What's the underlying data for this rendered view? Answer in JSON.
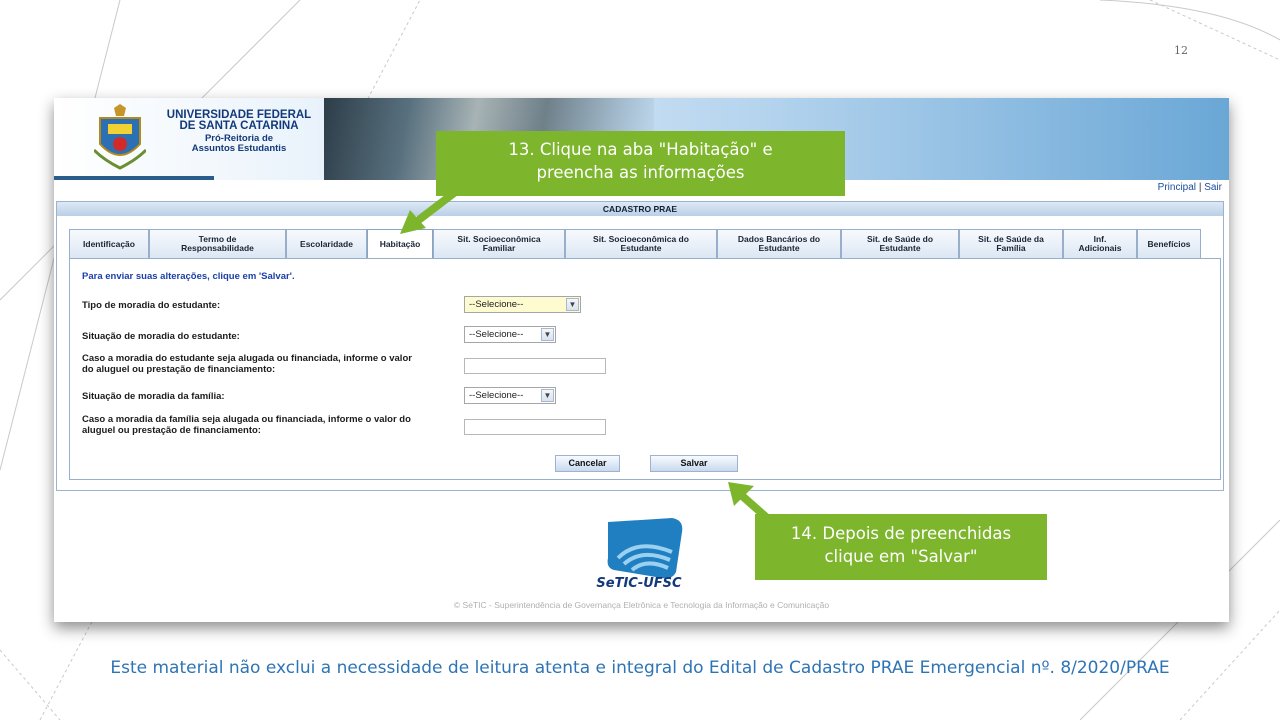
{
  "slide": {
    "page_number": "12",
    "bottom_note": "Este material não exclui a necessidade de leitura atenta e integral do Edital de Cadastro PRAE Emergencial nº. 8/2020/PRAE"
  },
  "header": {
    "university_line1": "UNIVERSIDADE FEDERAL",
    "university_line2": "DE SANTA CATARINA",
    "dept_line1": "Pró-Reitoria de",
    "dept_line2": "Assuntos Estudantis",
    "link_principal": "Principal",
    "link_separator": "|",
    "link_sair": "Sair"
  },
  "callouts": {
    "step13_line1": "13. Clique na aba \"Habitação\" e",
    "step13_line2": "preencha as informações",
    "step14_line1": "14. Depois de preenchidas",
    "step14_line2": "clique em \"Salvar\""
  },
  "panel": {
    "title": "CADASTRO PRAE",
    "tabs": [
      {
        "l1": "Identificação",
        "l2": ""
      },
      {
        "l1": "Termo de",
        "l2": "Responsabilidade"
      },
      {
        "l1": "Escolaridade",
        "l2": ""
      },
      {
        "l1": "Habitação",
        "l2": ""
      },
      {
        "l1": "Sit. Socioeconômica",
        "l2": "Familiar"
      },
      {
        "l1": "Sit. Socioeconômica do",
        "l2": "Estudante"
      },
      {
        "l1": "Dados Bancários do",
        "l2": "Estudante"
      },
      {
        "l1": "Sit. de Saúde do",
        "l2": "Estudante"
      },
      {
        "l1": "Sit. de Saúde da",
        "l2": "Família"
      },
      {
        "l1": "Inf.",
        "l2": "Adicionais"
      },
      {
        "l1": "Benefícios",
        "l2": ""
      }
    ],
    "active_tab": "Habitação"
  },
  "form": {
    "instruction": "Para enviar suas alterações, clique em 'Salvar'.",
    "tipo_moradia_label": "Tipo de moradia do estudante:",
    "tipo_moradia_value": "--Selecione--",
    "situacao_estudante_label": "Situação de moradia do estudante:",
    "situacao_estudante_value": "--Selecione--",
    "valor_estudante_label_l1": "Caso a moradia do estudante seja alugada ou financiada, informe o valor",
    "valor_estudante_label_l2": "do aluguel ou prestação de financiamento:",
    "valor_estudante_value": "",
    "situacao_familia_label": "Situação de moradia da família:",
    "situacao_familia_value": "--Selecione--",
    "valor_familia_label_l1": "Caso a moradia da família seja alugada ou financiada, informe o valor do",
    "valor_familia_label_l2": "aluguel ou prestação de financiamento:",
    "valor_familia_value": "",
    "cancel_label": "Cancelar",
    "save_label": "Salvar"
  },
  "footer": {
    "logo_text": "SeTIC-UFSC",
    "credit": "© SeTIC - Superintendência de Governança Eletrônica e Tecnologia da Informação e Comunicação"
  },
  "colors": {
    "callout_green": "#7db52d",
    "note_blue": "#2e74b5",
    "link_blue": "#1c4fa0"
  }
}
